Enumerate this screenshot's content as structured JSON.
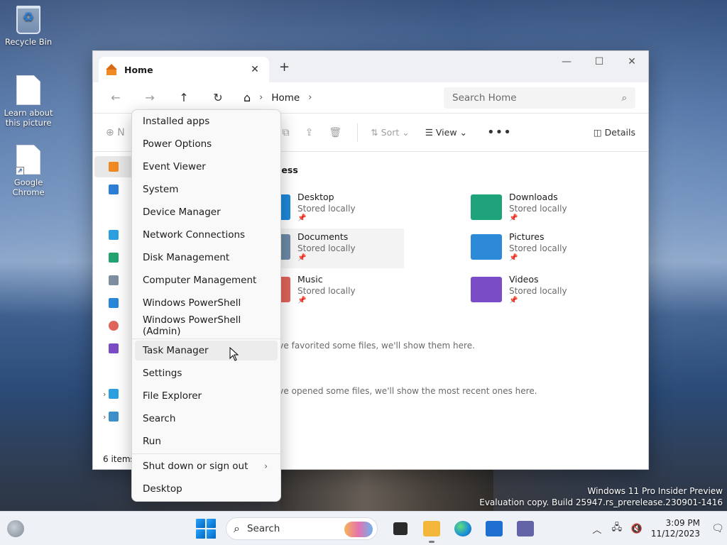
{
  "desktop": {
    "icons": [
      {
        "label": "Recycle Bin"
      },
      {
        "label": "Learn about this picture"
      },
      {
        "label": "Google Chrome"
      }
    ]
  },
  "explorer": {
    "tab_title": "Home",
    "tab_close": "✕",
    "new_tab": "+",
    "window_controls": {
      "minimize": "—",
      "maximize": "☐",
      "close": "✕"
    },
    "nav": {
      "back": "←",
      "forward": "→",
      "up": "↑",
      "refresh": "↻"
    },
    "breadcrumb": {
      "home_glyph": "⌂",
      "sep": "›",
      "path": "Home",
      "trail": "›"
    },
    "search_placeholder": "Search Home",
    "search_glyph": "⌕",
    "command_bar": {
      "new_label": "N",
      "sort_label": "Sort",
      "view_label": "View",
      "more_label": "•••",
      "details_label": "Details"
    },
    "section_partial": "cess",
    "folders": [
      {
        "name": "Desktop",
        "sub": "Stored locally",
        "pin": "📌",
        "color": "#1e88d8"
      },
      {
        "name": "Downloads",
        "sub": "Stored locally",
        "pin": "📌",
        "color": "#1fa37a"
      },
      {
        "name": "Documents",
        "sub": "Stored locally",
        "pin": "📌",
        "color": "#6c8aa6"
      },
      {
        "name": "Pictures",
        "sub": "Stored locally",
        "pin": "📌",
        "color": "#2d8ad8"
      },
      {
        "name": "Music",
        "sub": "Stored locally",
        "pin": "📌",
        "color": "#e0645a"
      },
      {
        "name": "Videos",
        "sub": "Stored locally",
        "pin": "📌",
        "color": "#7a4cc6"
      }
    ],
    "favorites_msg": "'ve favorited some files, we'll show them here.",
    "recent_msg": "'ve opened some files, we'll show the most recent ones here.",
    "status": "6 items"
  },
  "context_menu": {
    "items": [
      {
        "label": "Installed apps"
      },
      {
        "label": "Power Options"
      },
      {
        "label": "Event Viewer"
      },
      {
        "label": "System"
      },
      {
        "label": "Device Manager"
      },
      {
        "label": "Network Connections"
      },
      {
        "label": "Disk Management"
      },
      {
        "label": "Computer Management"
      },
      {
        "label": "Windows PowerShell"
      },
      {
        "label": "Windows PowerShell (Admin)"
      },
      {
        "label": "Task Manager"
      },
      {
        "label": "Settings"
      },
      {
        "label": "File Explorer"
      },
      {
        "label": "Search"
      },
      {
        "label": "Run"
      },
      {
        "label": "Shut down or sign out",
        "submenu_arrow": "›"
      },
      {
        "label": "Desktop"
      }
    ],
    "hovered": "Task Manager"
  },
  "watermark": {
    "line1": "Windows 11 Pro Insider Preview",
    "line2": "Evaluation copy. Build 25947.rs_prerelease.230901-1416"
  },
  "taskbar": {
    "search_label": "Search",
    "search_glyph": "⌕",
    "tray_chevron": "︿",
    "time": "3:09 PM",
    "date": "11/12/2023",
    "notification_glyph": "🗨"
  }
}
